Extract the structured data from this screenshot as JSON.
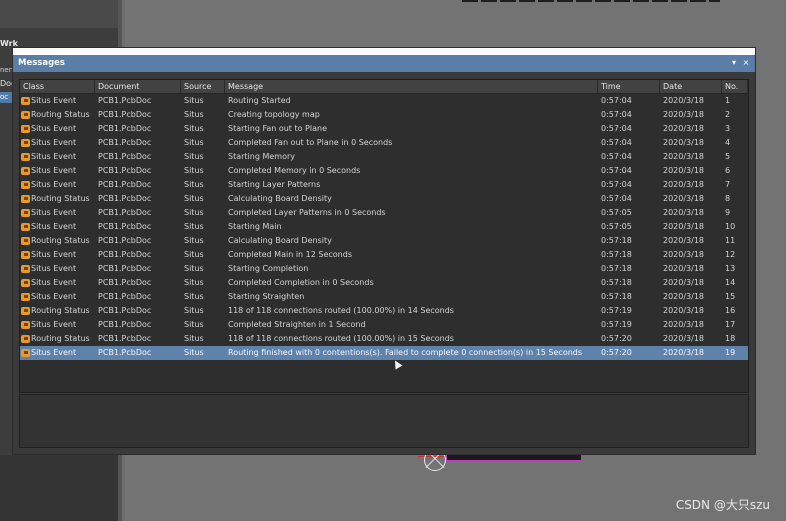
{
  "left_panel": {
    "title": "Wrk",
    "line1": "nen",
    "line2": "Doc",
    "selected": "oc"
  },
  "panel": {
    "title": "Messages",
    "pin_label": "▾",
    "close_label": "×"
  },
  "columns": {
    "class": "Class",
    "document": "Document",
    "source": "Source",
    "message": "Message",
    "time": "Time",
    "date": "Date",
    "no": "No."
  },
  "rows": [
    {
      "class": "Situs Event",
      "document": "PCB1.PcbDoc",
      "source": "Situs",
      "message": "Routing Started",
      "time": "0:57:04",
      "date": "2020/3/18",
      "no": "1"
    },
    {
      "class": "Routing Status",
      "document": "PCB1.PcbDoc",
      "source": "Situs",
      "message": "Creating topology map",
      "time": "0:57:04",
      "date": "2020/3/18",
      "no": "2"
    },
    {
      "class": "Situs Event",
      "document": "PCB1.PcbDoc",
      "source": "Situs",
      "message": "Starting Fan out to Plane",
      "time": "0:57:04",
      "date": "2020/3/18",
      "no": "3"
    },
    {
      "class": "Situs Event",
      "document": "PCB1.PcbDoc",
      "source": "Situs",
      "message": "Completed Fan out to Plane in 0 Seconds",
      "time": "0:57:04",
      "date": "2020/3/18",
      "no": "4"
    },
    {
      "class": "Situs Event",
      "document": "PCB1.PcbDoc",
      "source": "Situs",
      "message": "Starting Memory",
      "time": "0:57:04",
      "date": "2020/3/18",
      "no": "5"
    },
    {
      "class": "Situs Event",
      "document": "PCB1.PcbDoc",
      "source": "Situs",
      "message": "Completed Memory in 0 Seconds",
      "time": "0:57:04",
      "date": "2020/3/18",
      "no": "6"
    },
    {
      "class": "Situs Event",
      "document": "PCB1.PcbDoc",
      "source": "Situs",
      "message": "Starting Layer Patterns",
      "time": "0:57:04",
      "date": "2020/3/18",
      "no": "7"
    },
    {
      "class": "Routing Status",
      "document": "PCB1.PcbDoc",
      "source": "Situs",
      "message": "Calculating Board Density",
      "time": "0:57:04",
      "date": "2020/3/18",
      "no": "8"
    },
    {
      "class": "Situs Event",
      "document": "PCB1.PcbDoc",
      "source": "Situs",
      "message": "Completed Layer Patterns in 0 Seconds",
      "time": "0:57:05",
      "date": "2020/3/18",
      "no": "9"
    },
    {
      "class": "Situs Event",
      "document": "PCB1.PcbDoc",
      "source": "Situs",
      "message": "Starting Main",
      "time": "0:57:05",
      "date": "2020/3/18",
      "no": "10"
    },
    {
      "class": "Routing Status",
      "document": "PCB1.PcbDoc",
      "source": "Situs",
      "message": "Calculating Board Density",
      "time": "0:57:18",
      "date": "2020/3/18",
      "no": "11"
    },
    {
      "class": "Situs Event",
      "document": "PCB1.PcbDoc",
      "source": "Situs",
      "message": "Completed Main in 12 Seconds",
      "time": "0:57:18",
      "date": "2020/3/18",
      "no": "12"
    },
    {
      "class": "Situs Event",
      "document": "PCB1.PcbDoc",
      "source": "Situs",
      "message": "Starting Completion",
      "time": "0:57:18",
      "date": "2020/3/18",
      "no": "13"
    },
    {
      "class": "Situs Event",
      "document": "PCB1.PcbDoc",
      "source": "Situs",
      "message": "Completed Completion in 0 Seconds",
      "time": "0:57:18",
      "date": "2020/3/18",
      "no": "14"
    },
    {
      "class": "Situs Event",
      "document": "PCB1.PcbDoc",
      "source": "Situs",
      "message": "Starting Straighten",
      "time": "0:57:18",
      "date": "2020/3/18",
      "no": "15"
    },
    {
      "class": "Routing Status",
      "document": "PCB1.PcbDoc",
      "source": "Situs",
      "message": "118 of 118 connections routed (100.00%) in 14 Seconds",
      "time": "0:57:19",
      "date": "2020/3/18",
      "no": "16"
    },
    {
      "class": "Situs Event",
      "document": "PCB1.PcbDoc",
      "source": "Situs",
      "message": "Completed Straighten in 1 Second",
      "time": "0:57:19",
      "date": "2020/3/18",
      "no": "17"
    },
    {
      "class": "Routing Status",
      "document": "PCB1.PcbDoc",
      "source": "Situs",
      "message": "118 of 118 connections routed (100.00%) in 15 Seconds",
      "time": "0:57:20",
      "date": "2020/3/18",
      "no": "18"
    },
    {
      "class": "Situs Event",
      "document": "PCB1.PcbDoc",
      "source": "Situs",
      "message": "Routing finished  with 0 contentions(s). Failed to complete 0 connection(s) in 15 Seconds",
      "time": "0:57:20",
      "date": "2020/3/18",
      "no": "19",
      "selected": true
    }
  ],
  "watermark": "CSDN @大只szu",
  "colors": {
    "titlebar": "#5a7ea8",
    "selection": "#5f82ab",
    "event_icon": "#e79a2a"
  },
  "icons": {
    "row_icon": "situs-event-icon"
  }
}
